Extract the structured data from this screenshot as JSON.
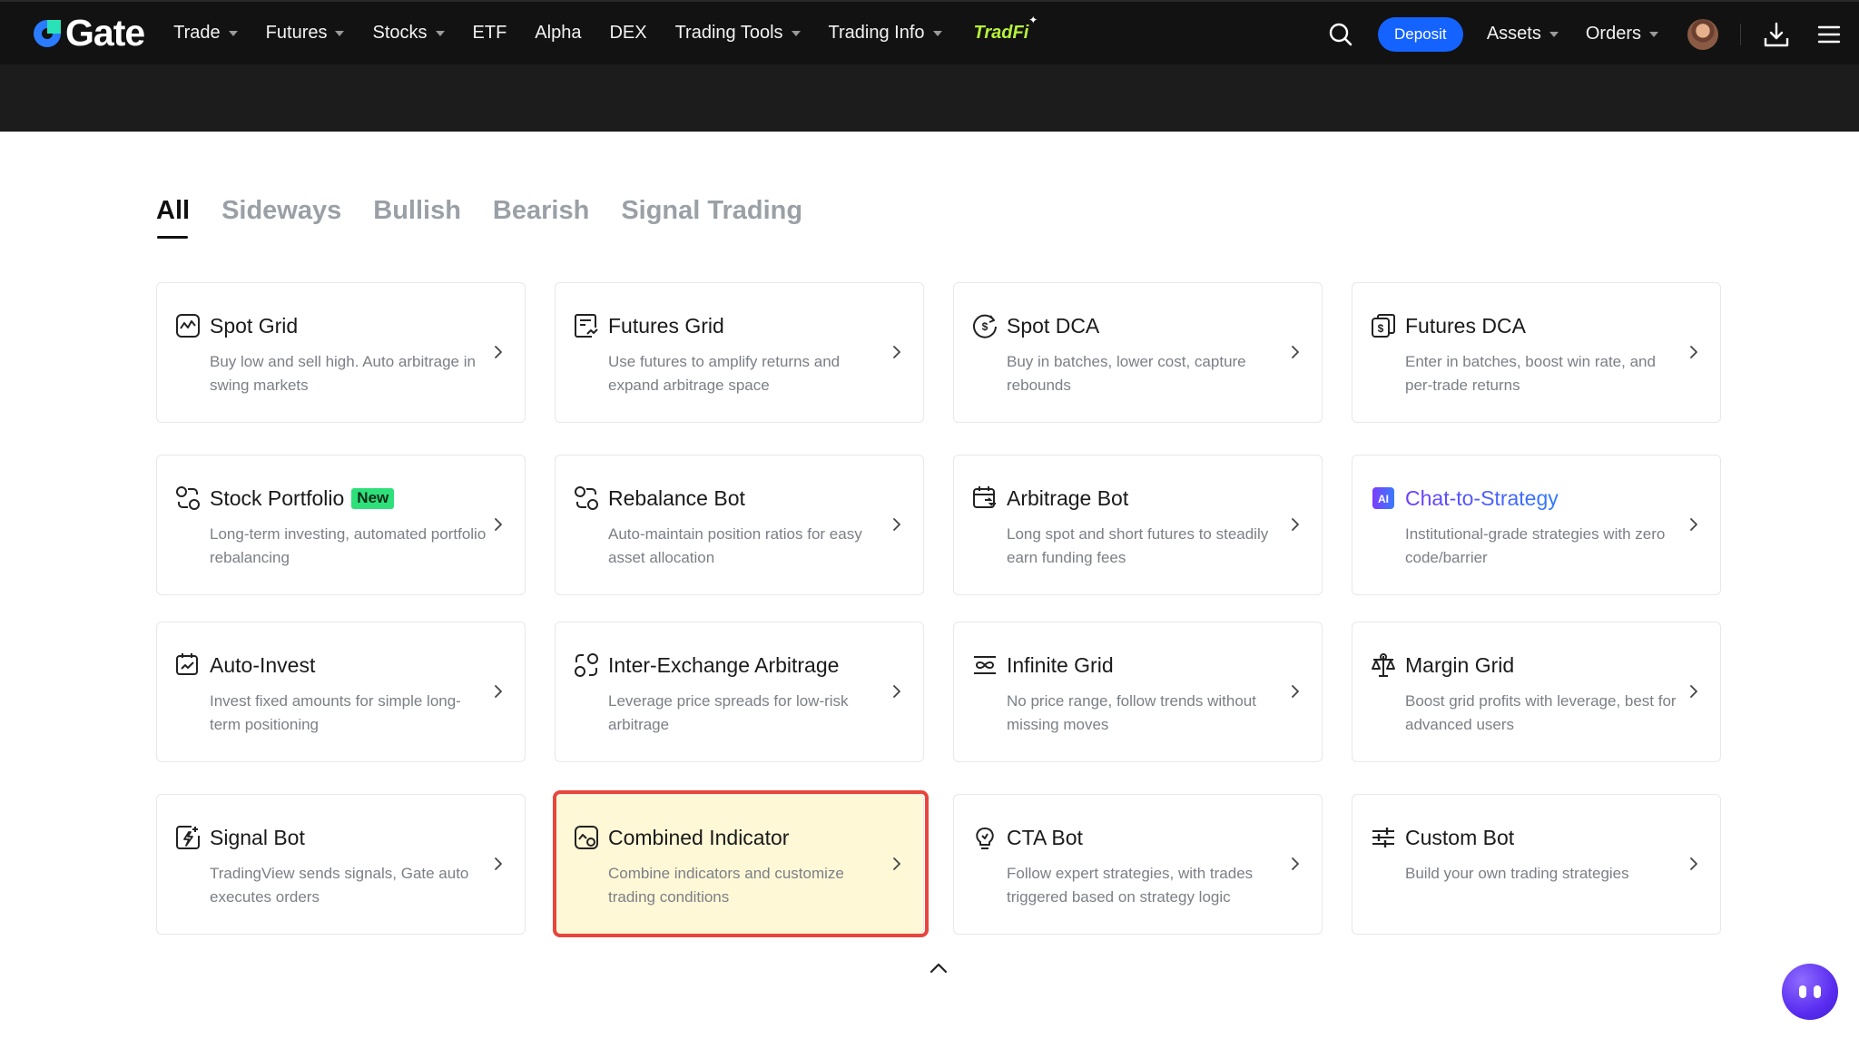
{
  "app": {
    "logo_text": "Gate"
  },
  "nav": {
    "items": [
      {
        "label": "Trade",
        "dropdown": true
      },
      {
        "label": "Futures",
        "dropdown": true
      },
      {
        "label": "Stocks",
        "dropdown": true
      },
      {
        "label": "ETF",
        "dropdown": false
      },
      {
        "label": "Alpha",
        "dropdown": false
      },
      {
        "label": "DEX",
        "dropdown": false
      },
      {
        "label": "Trading Tools",
        "dropdown": true
      },
      {
        "label": "Trading Info",
        "dropdown": true
      }
    ],
    "tradfi_label": "TradFi",
    "deposit_label": "Deposit",
    "assets_label": "Assets",
    "orders_label": "Orders"
  },
  "tabs": [
    {
      "label": "All",
      "active": true
    },
    {
      "label": "Sideways",
      "active": false
    },
    {
      "label": "Bullish",
      "active": false
    },
    {
      "label": "Bearish",
      "active": false
    },
    {
      "label": "Signal Trading",
      "active": false
    }
  ],
  "cards": [
    {
      "title": "Spot Grid",
      "desc": "Buy low and sell high. Auto arbitrage in swing markets",
      "icon": "chart-grid-icon"
    },
    {
      "title": "Futures Grid",
      "desc": "Use futures to amplify returns and expand arbitrage space",
      "icon": "futures-chart-icon"
    },
    {
      "title": "Spot DCA",
      "desc": "Buy in batches, lower cost, capture rebounds",
      "icon": "dollar-cycle-icon"
    },
    {
      "title": "Futures DCA",
      "desc": "Enter in batches, boost win rate, and per-trade returns",
      "icon": "dollar-doc-icon"
    },
    {
      "title": "Stock Portfolio",
      "badge": "New",
      "desc": "Long-term investing, automated portfolio rebalancing",
      "icon": "portfolio-icon"
    },
    {
      "title": "Rebalance Bot",
      "desc": "Auto-maintain position ratios for easy asset allocation",
      "icon": "rebalance-icon"
    },
    {
      "title": "Arbitrage Bot",
      "desc": "Long spot and short futures to steadily earn funding fees",
      "icon": "calendar-arbitrage-icon"
    },
    {
      "title": "Chat-to-Strategy",
      "desc": "Institutional-grade strategies with zero code/barrier",
      "icon": "ai-chat-icon",
      "accent": true
    },
    {
      "title": "Auto-Invest",
      "desc": "Invest fixed amounts for simple long-term positioning",
      "icon": "calendar-invest-icon"
    },
    {
      "title": "Inter-Exchange Arbitrage",
      "desc": "Leverage price spreads for low-risk arbitrage",
      "icon": "exchange-icon"
    },
    {
      "title": "Infinite Grid",
      "desc": "No price range, follow trends without missing moves",
      "icon": "infinity-icon"
    },
    {
      "title": "Margin Grid",
      "desc": "Boost grid profits with leverage, best for advanced users",
      "icon": "scale-icon"
    },
    {
      "title": "Signal Bot",
      "desc": "TradingView sends signals, Gate auto executes orders",
      "icon": "signal-icon"
    },
    {
      "title": "Combined Indicator",
      "desc": "Combine indicators and customize trading conditions",
      "icon": "indicator-icon",
      "highlighted": true
    },
    {
      "title": "CTA Bot",
      "desc": "Follow expert strategies, with trades triggered based on strategy logic",
      "icon": "bulb-icon"
    },
    {
      "title": "Custom Bot",
      "desc": "Build your own trading strategies",
      "icon": "sliders-icon"
    }
  ],
  "colors": {
    "nav_bg": "#121212",
    "deposit": "#1463ff",
    "highlight_bg": "#fff8d6",
    "highlight_border": "#e8453c",
    "badge_new": "#2ee07a",
    "tradfi": "#b6f23a"
  }
}
